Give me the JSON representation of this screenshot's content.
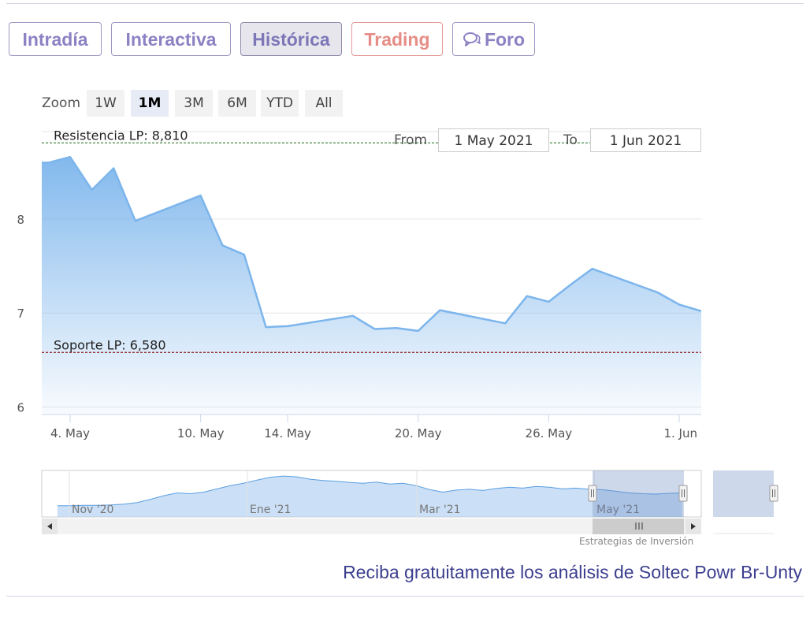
{
  "tabs": [
    {
      "label": "Intradía"
    },
    {
      "label": "Interactiva"
    },
    {
      "label": "Histórica"
    },
    {
      "label": "Trading"
    },
    {
      "label": "Foro"
    }
  ],
  "zoom": {
    "label": "Zoom",
    "buttons": [
      "1W",
      "1M",
      "3M",
      "6M",
      "YTD",
      "All"
    ],
    "selected": "1M"
  },
  "range": {
    "from_label": "From",
    "from_value": "1 May 2021",
    "to_label": "To",
    "to_value": "1 Jun 2021"
  },
  "chart_data": {
    "type": "area",
    "title": "",
    "x": [
      "3 May",
      "4 May",
      "5 May",
      "6 May",
      "7 May",
      "10 May",
      "11 May",
      "12 May",
      "13 May",
      "14 May",
      "17 May",
      "18 May",
      "19 May",
      "20 May",
      "21 May",
      "24 May",
      "25 May",
      "26 May",
      "27 May",
      "28 May",
      "31 May",
      "1 Jun"
    ],
    "y": [
      8.6,
      8.66,
      8.31,
      8.54,
      7.98,
      8.25,
      7.72,
      7.62,
      6.85,
      6.86,
      6.97,
      6.83,
      6.84,
      6.81,
      7.03,
      6.89,
      7.18,
      7.12,
      7.3,
      7.47,
      7.22,
      7.09
    ],
    "y_last": 7.02,
    "xticks": [
      "4. May",
      "10. May",
      "14. May",
      "20. May",
      "26. May",
      "1. Jun"
    ],
    "yticks": [
      6,
      7,
      8
    ],
    "ylim": [
      5.92,
      8.93
    ],
    "color": "#7cb5ec",
    "grid": true,
    "plot_lines": [
      {
        "label": "Resistencia LP: 8,810",
        "value": 8.81,
        "color": "#2e7d32"
      },
      {
        "label": "Soporte LP: 6,580",
        "value": 6.58,
        "color": "#8b1a1a"
      }
    ],
    "navigator": {
      "labels": [
        "Nov '20",
        "Ene '21",
        "Mar '21",
        "May '21"
      ],
      "values": [
        2,
        2,
        2.1,
        2.1,
        2.2,
        2.4,
        2.8,
        3.6,
        4.5,
        5.2,
        5.0,
        5.4,
        6.2,
        7.0,
        7.6,
        8.4,
        9.1,
        9.4,
        9.2,
        8.6,
        8.3,
        8.1,
        7.8,
        7.6,
        7.9,
        7.4,
        7.6,
        7.0,
        6.0,
        5.4,
        5.9,
        6.1,
        5.8,
        6.3,
        6.6,
        6.4,
        6.8,
        6.6,
        6.2,
        6.4,
        6.1,
        6.0,
        5.6,
        5.2,
        5.0,
        4.9,
        5.1,
        5.2
      ]
    }
  },
  "credits": "Estrategias de Inversión",
  "footer": {
    "text": "Reciba gratuitamente los análisis de Soltec Powr Br-Unty"
  }
}
